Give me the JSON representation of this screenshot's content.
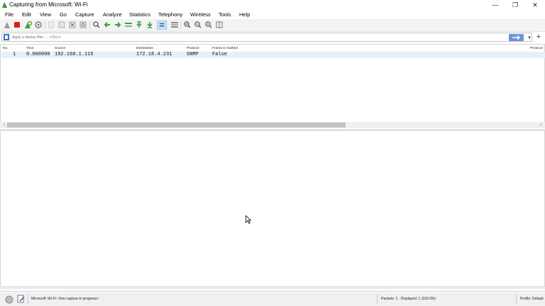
{
  "window": {
    "title": "Capturing from Microsoft: Wi-Fi",
    "controls": {
      "minimize": "—",
      "restore": "❐",
      "close": "✕"
    }
  },
  "menu": [
    "File",
    "Edit",
    "View",
    "Go",
    "Capture",
    "Analyze",
    "Statistics",
    "Telephony",
    "Wireless",
    "Tools",
    "Help"
  ],
  "toolbar": {
    "icons": [
      "shark-fin-start-icon",
      "stop-capture-icon",
      "restart-capture-icon",
      "capture-options-icon",
      "open-file-icon",
      "save-file-icon",
      "close-file-icon",
      "reload-file-icon",
      "find-packet-icon",
      "go-back-icon",
      "go-forward-icon",
      "go-to-packet-icon",
      "first-packet-icon",
      "last-packet-icon",
      "autoscroll-icon",
      "colorize-icon",
      "zoom-in-icon",
      "zoom-out-icon",
      "zoom-normal-icon",
      "resize-columns-icon"
    ]
  },
  "filter": {
    "placeholder": "Apply a display filter … <Ctrl-/>",
    "apply_icon": "arrow-right-icon",
    "add_label": "+"
  },
  "packet_list": {
    "columns": [
      "No.",
      "Time",
      "Source",
      "Destination",
      "Protocol",
      "Frame is marked",
      "Protocol"
    ],
    "rows": [
      {
        "no": "1",
        "time": "0.000000",
        "source": "192.168.1.115",
        "destination": "172.18.4.231",
        "protocol": "SNMP",
        "marked": "False"
      }
    ]
  },
  "status": {
    "capture_info": "Microsoft: Wi-Fi: <live capture in progress>",
    "packets": "Packets: 1 · Displayed: 1 (100.0%)",
    "profile": "Profile: Default"
  },
  "colors": {
    "selected_row": "#e4f0fb",
    "stop_red": "#d62020",
    "shark_green": "#3aa335",
    "apply_blue": "#6a96d8"
  }
}
